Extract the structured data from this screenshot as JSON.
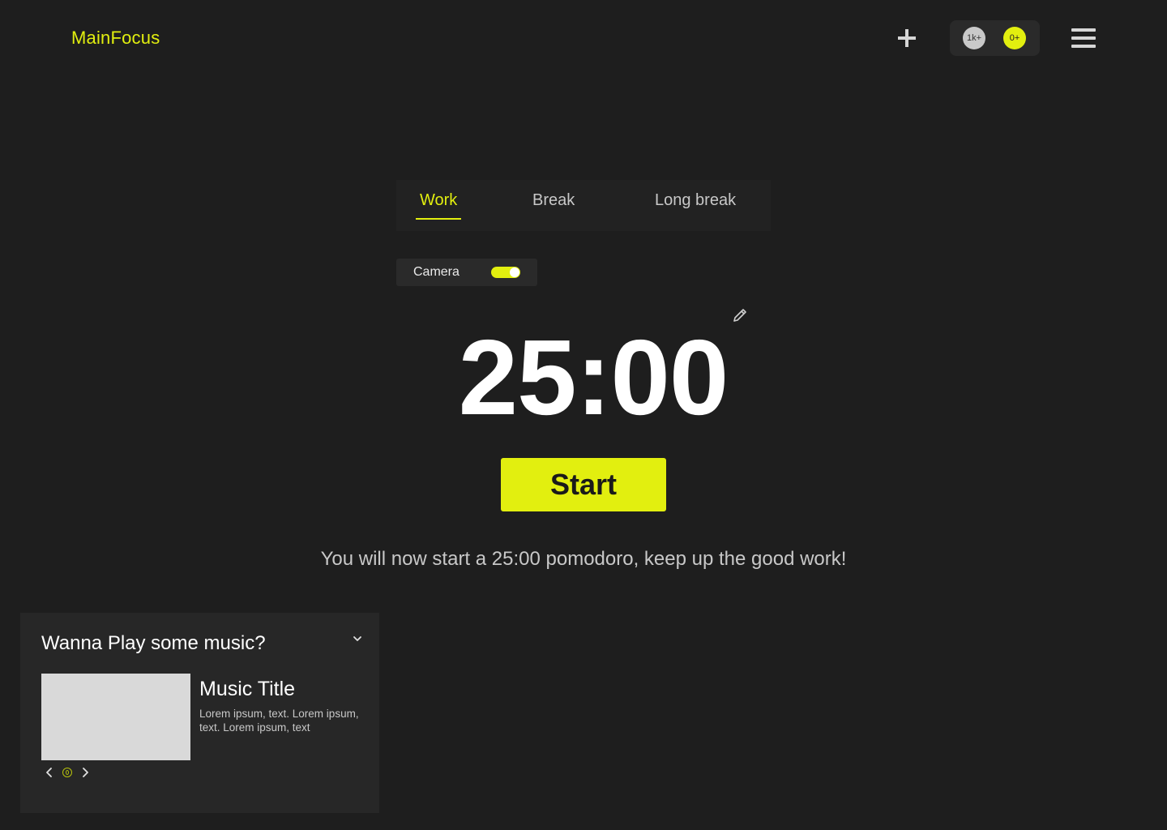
{
  "header": {
    "logo": "MainFocus",
    "add_icon": "plus-icon",
    "stats": [
      {
        "label": "1k+",
        "color": "#c9c9c9"
      },
      {
        "label": "0+",
        "color": "#e2ef0f"
      }
    ],
    "menu_icon": "hamburger-menu-icon"
  },
  "tabs": [
    {
      "label": "Work",
      "active": true
    },
    {
      "label": "Break",
      "active": false
    },
    {
      "label": "Long break",
      "active": false
    }
  ],
  "camera": {
    "label": "Camera",
    "enabled": true
  },
  "timer": {
    "value": "25:00",
    "edit_icon": "pencil-icon"
  },
  "start_button": "Start",
  "message": "You will now start a 25:00 pomodoro, keep up the good work!",
  "music": {
    "heading": "Wanna Play some music?",
    "collapse_icon": "chevron-down-icon",
    "title": "Music Title",
    "description": "Lorem ipsum, text. Lorem ipsum, text. Lorem ipsum, text"
  },
  "colors": {
    "accent": "#e2ef0f",
    "background": "#1e1e1e",
    "panel": "#272727"
  }
}
